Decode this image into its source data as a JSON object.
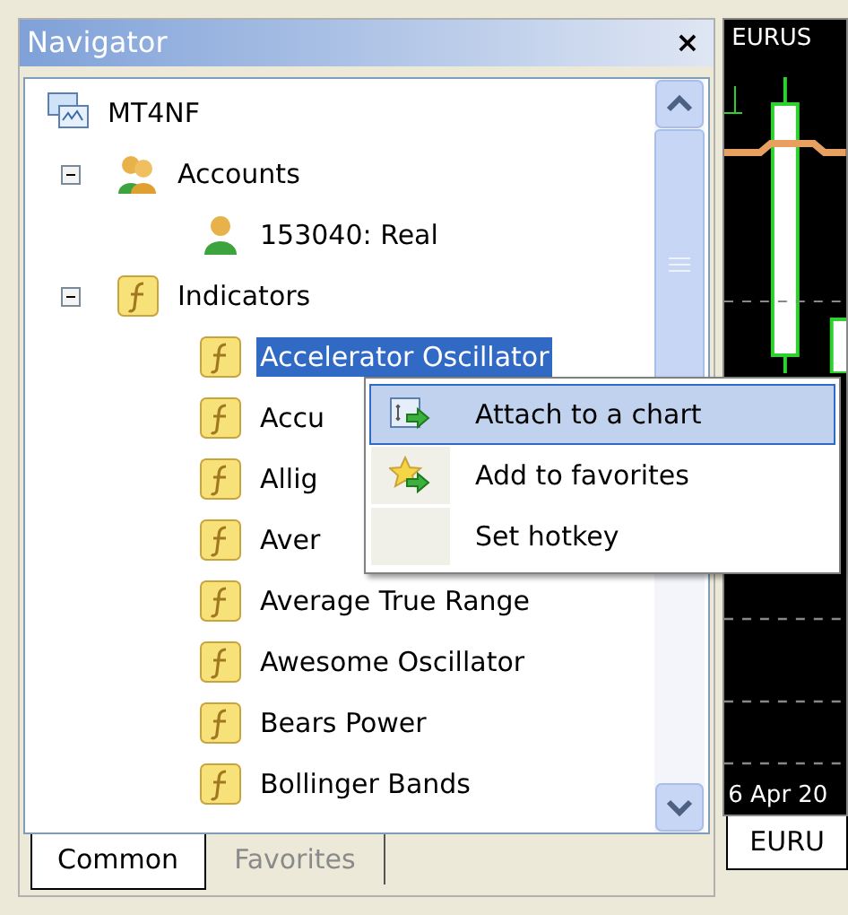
{
  "navigator": {
    "title": "Navigator",
    "close": "×",
    "tree": [
      {
        "label": "MT4NF",
        "kind": "terminal",
        "children": [
          {
            "label": "Accounts",
            "kind": "accounts",
            "expanded": true,
            "children": [
              {
                "label": "153040: Real",
                "kind": "account"
              }
            ]
          },
          {
            "label": "Indicators",
            "kind": "folder",
            "expanded": true,
            "children": [
              {
                "label": "Accelerator Oscillator",
                "kind": "indicator",
                "selected": true
              },
              {
                "label": "Accu",
                "kind": "indicator",
                "selected": false
              },
              {
                "label": "Allig",
                "kind": "indicator",
                "selected": false
              },
              {
                "label": "Aver",
                "kind": "indicator",
                "selected": false
              },
              {
                "label": "Average True Range",
                "kind": "indicator",
                "selected": false
              },
              {
                "label": "Awesome Oscillator",
                "kind": "indicator",
                "selected": false
              },
              {
                "label": "Bears Power",
                "kind": "indicator",
                "selected": false
              },
              {
                "label": "Bollinger Bands",
                "kind": "indicator",
                "selected": false
              }
            ]
          }
        ]
      }
    ],
    "tabs": [
      {
        "label": "Common",
        "selected": true
      },
      {
        "label": "Favorites",
        "selected": false
      }
    ]
  },
  "context_menu": {
    "items": [
      {
        "label": "Attach to a chart",
        "kind": "attach",
        "highlighted": true
      },
      {
        "label": "Add to favorites",
        "kind": "favorite",
        "highlighted": false
      },
      {
        "label": "Set hotkey",
        "kind": "plain",
        "highlighted": false
      }
    ]
  },
  "chart": {
    "title": "EURUS",
    "date": "6 Apr 20",
    "tab": "EURU"
  }
}
